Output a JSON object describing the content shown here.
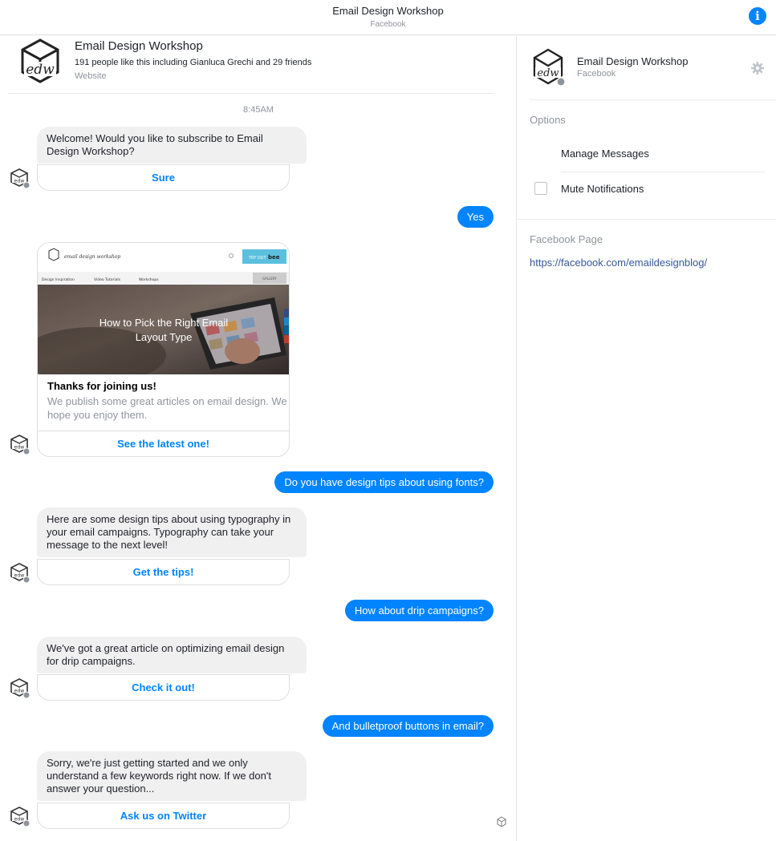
{
  "header": {
    "title": "Email Design Workshop",
    "subtitle": "Facebook",
    "info_icon": "info-icon"
  },
  "page": {
    "name": "Email Design Workshop",
    "likes": "191 people like this including Gianluca Grechi and 29 friends",
    "kind": "Website",
    "logo_text": "edw"
  },
  "conversation": {
    "timestamp": "8:45AM",
    "welcome": "Welcome! Would you like to subscribe to Email Design Workshop?",
    "welcome_reply": "Sure",
    "user_yes": "Yes",
    "card": {
      "preview_brand": "email design workshop",
      "preview_nav": [
        "Design Inspiration",
        "Video Tutorials",
        "Workshops"
      ],
      "preview_gallery": "GALLERY",
      "preview_try": "TRY OUT",
      "preview_bee": "bee",
      "preview_headline": "How to Pick the Right Email Layout Type",
      "title": "Thanks for joining us!",
      "subtitle": "We publish some great articles on email design. We hope you enjoy them.",
      "button": "See the latest one!"
    },
    "user_fonts": "Do you have design tips about using fonts?",
    "typography": "Here are some design tips about using typography in your email campaigns. Typography can take your message to the next level!",
    "typography_reply": "Get the tips!",
    "user_drip": "How about drip campaigns?",
    "drip": "We've got a great article on optimizing email design for drip campaigns.",
    "drip_reply": "Check it out!",
    "user_buttons": "And bulletproof buttons in email?",
    "sorry": "Sorry, we're just getting started and we only understand a few keywords right now. If we don't answer your question...",
    "sorry_reply": "Ask us on Twitter"
  },
  "panel": {
    "name": "Email Design Workshop",
    "subtitle": "Facebook",
    "options_label": "Options",
    "manage": "Manage Messages",
    "mute": "Mute Notifications",
    "fb_label": "Facebook Page",
    "fb_link": "https://facebook.com/emaildesignblog/"
  },
  "colors": {
    "accent": "#0084ff",
    "incoming_bubble": "#f1f0f0",
    "muted_text": "#90949c",
    "link": "#365899"
  }
}
